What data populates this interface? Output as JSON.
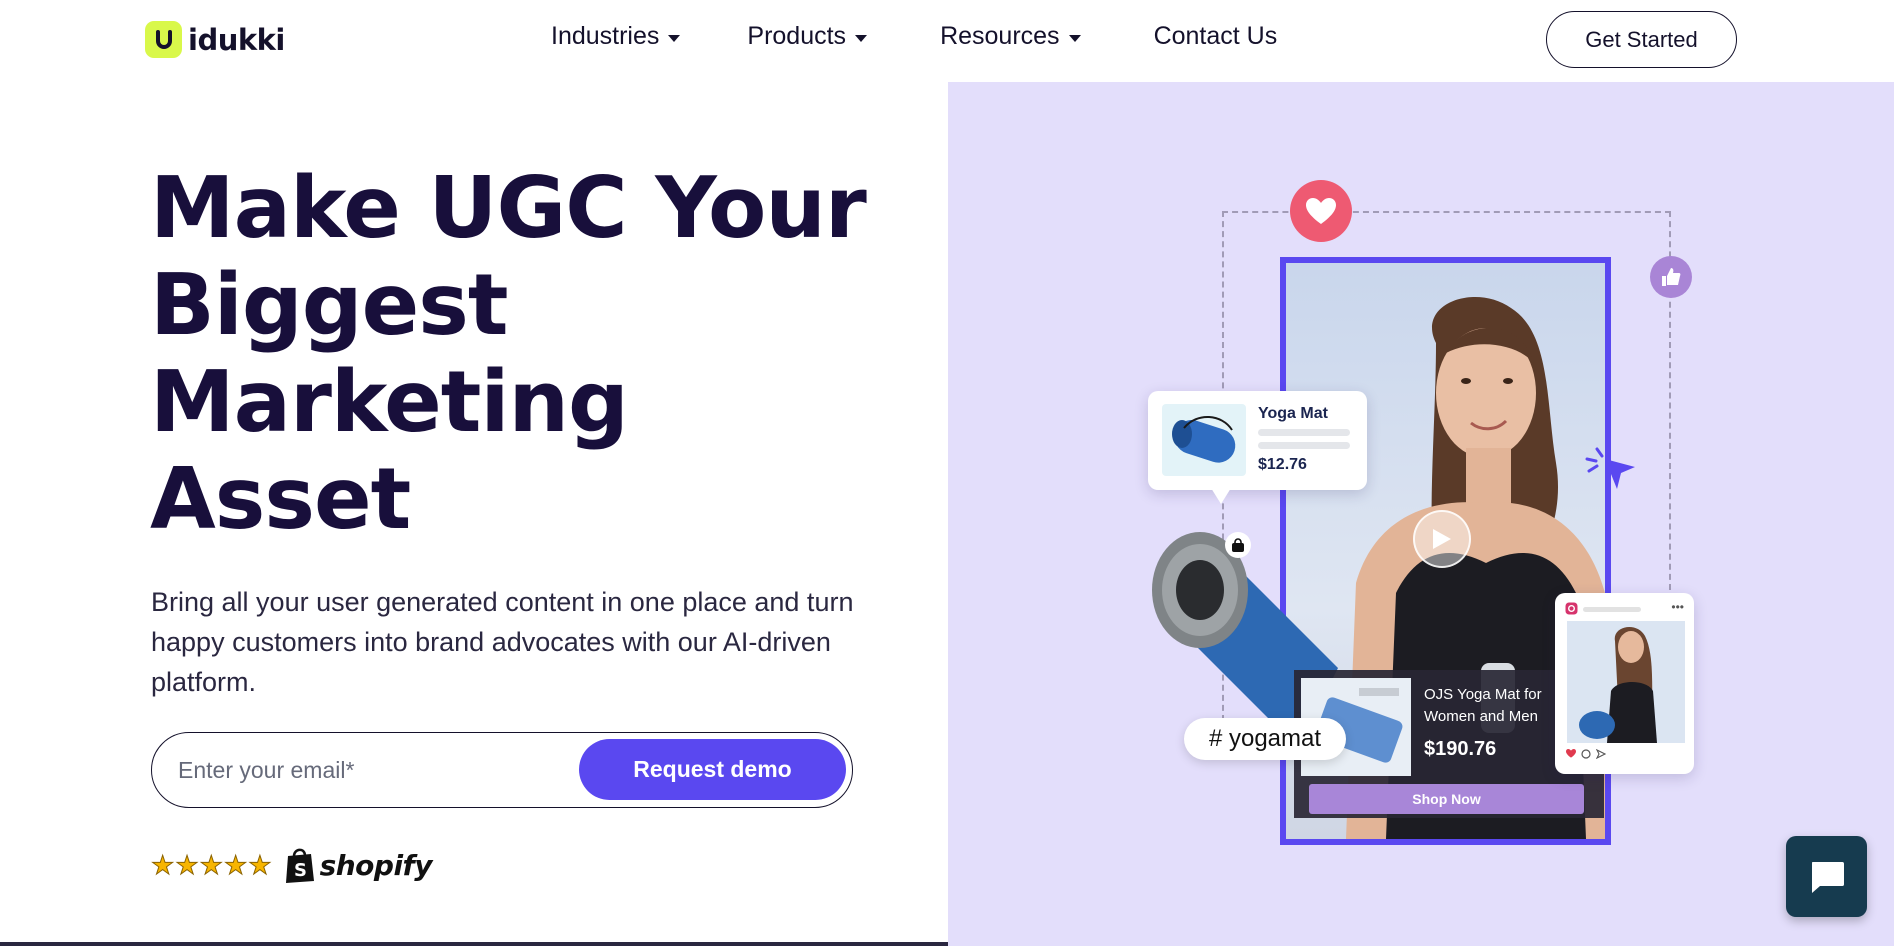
{
  "brand": {
    "name": "idukki",
    "logo_icon": "u-logo-icon",
    "accent_color": "#5a48f0",
    "logo_color": "#d9f84a"
  },
  "nav": {
    "items": [
      {
        "label": "Industries",
        "has_dropdown": true
      },
      {
        "label": "Products",
        "has_dropdown": true
      },
      {
        "label": "Resources",
        "has_dropdown": true
      },
      {
        "label": "Contact Us",
        "has_dropdown": false
      }
    ],
    "cta_label": "Get Started"
  },
  "hero": {
    "title_lines": [
      "Make UGC Your",
      "Biggest",
      "Marketing",
      "Asset"
    ],
    "subtitle": "Bring all your user generated content in one place and turn happy customers into brand advocates with our AI-driven platform.",
    "email_placeholder": "Enter your email*",
    "demo_button_label": "Request demo",
    "rating_stars": 5,
    "partner_name": "shopify",
    "panel_color": "#e3defb"
  },
  "illustration": {
    "product_card": {
      "name": "Yoga Mat",
      "price": "$12.76"
    },
    "hashtag": "# yogamat",
    "shop_card": {
      "product_name": "OJS Yoga Mat for Women and Men",
      "price": "$190.76",
      "button_label": "Shop Now"
    }
  },
  "chat_widget": {
    "icon": "chat-bubble-icon"
  }
}
